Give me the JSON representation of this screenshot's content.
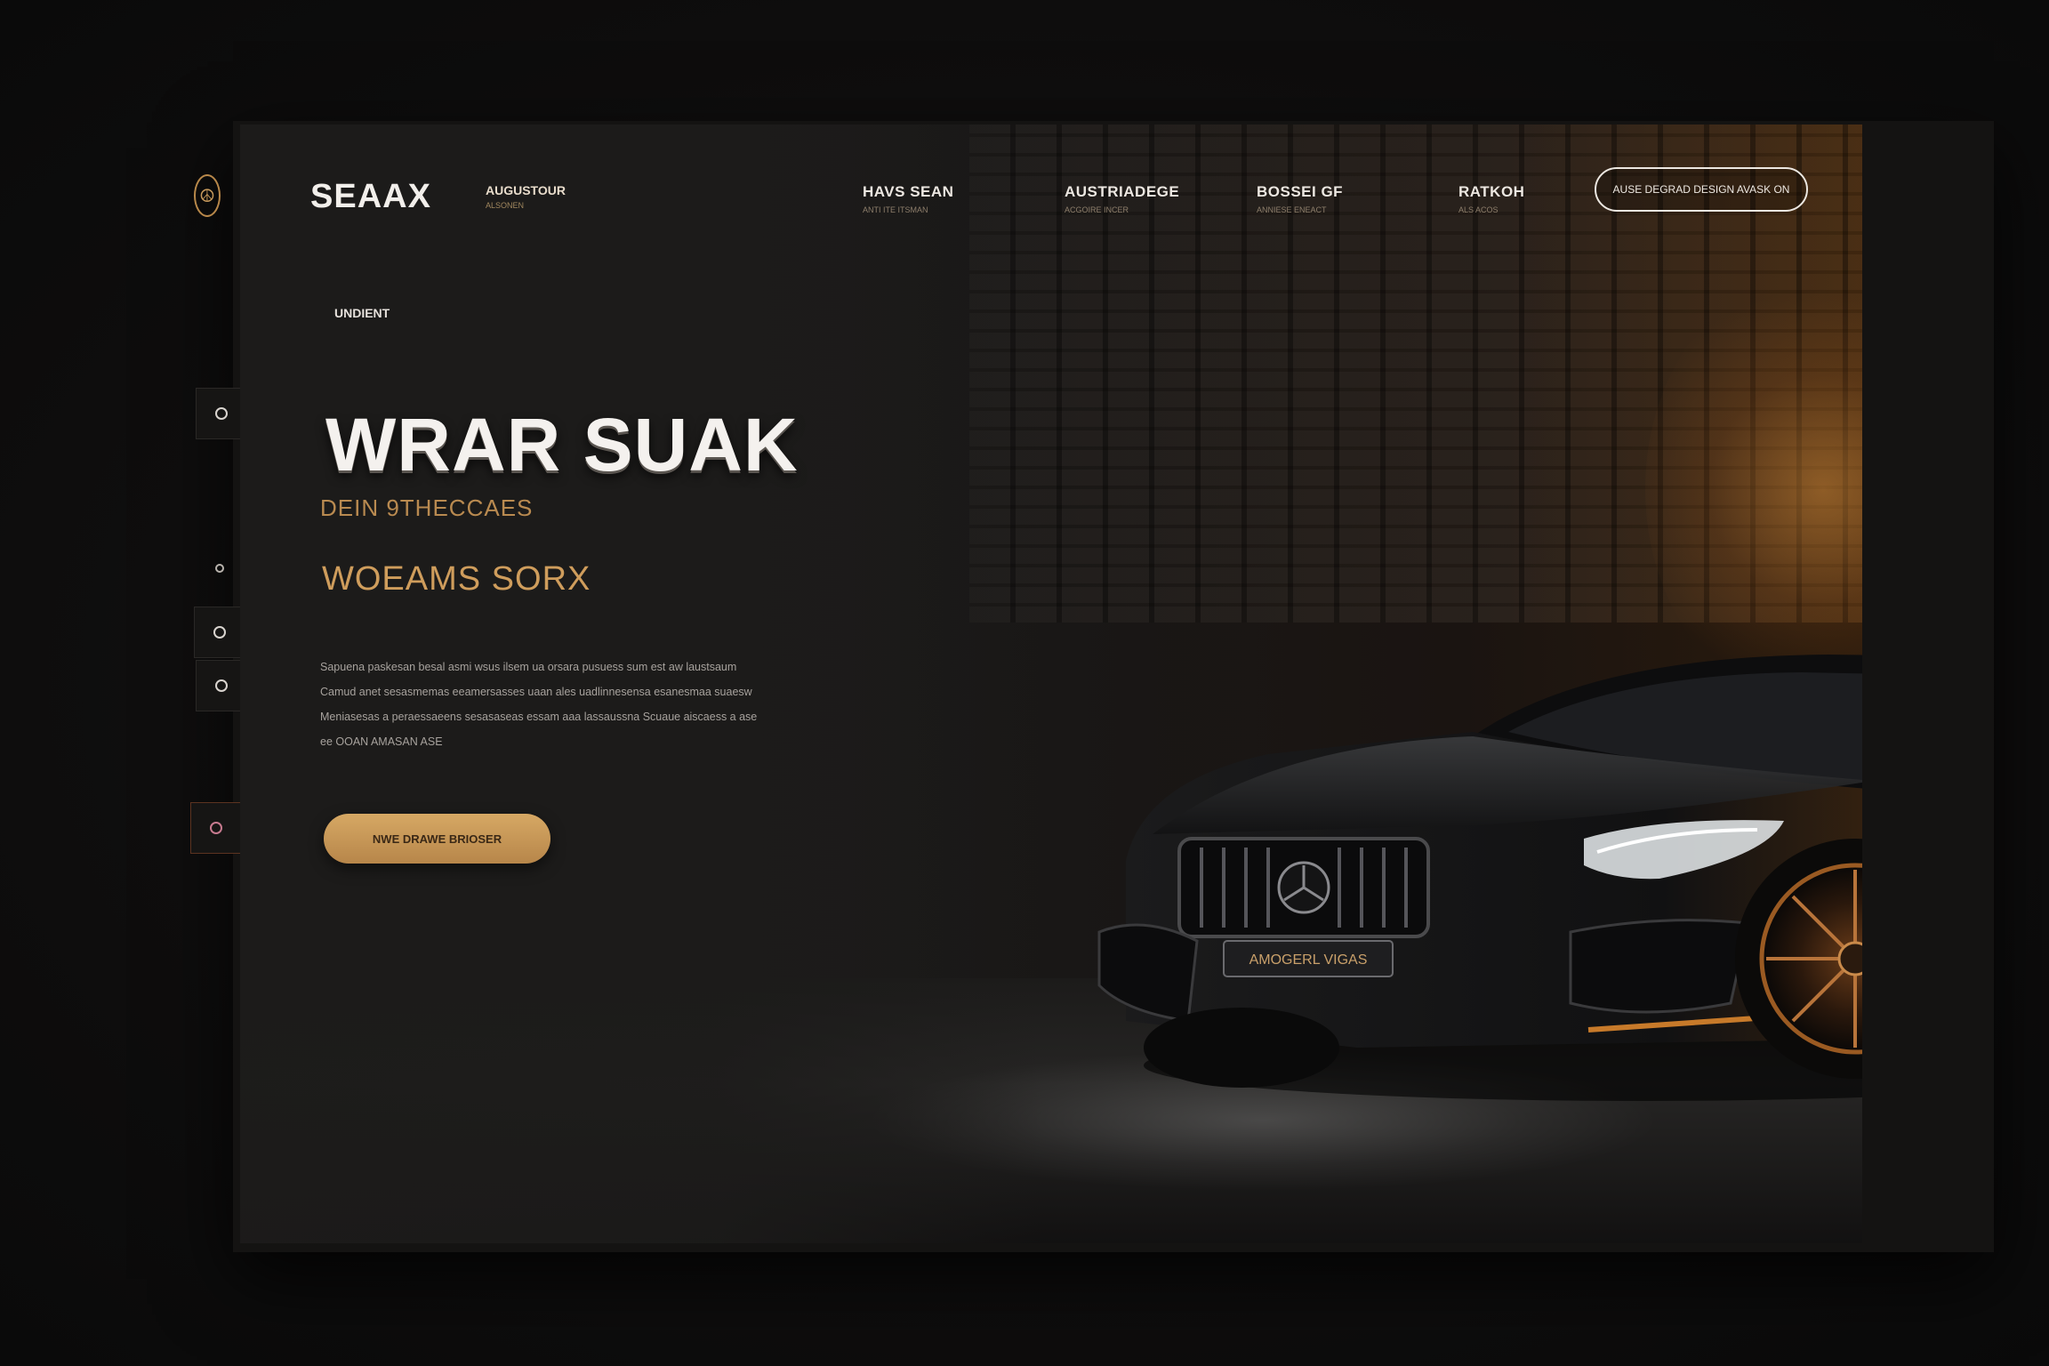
{
  "brand": {
    "name": "SEAAX",
    "sub_label": "AUGUSTOUR",
    "sub_caption": "ALSONEN"
  },
  "nav": {
    "items": [
      {
        "label": "HAVS SEAN",
        "caption": "ANTI ITE ITSMAN"
      },
      {
        "label": "AUSTRIADEGE",
        "caption": "ACGOIRE INCER"
      },
      {
        "label": "BOSSEI GF",
        "caption": "ANNIESE ENEACT"
      },
      {
        "label": "RATKOH",
        "caption": "ALS ACOS"
      }
    ],
    "cta_label": "AUSE DEGRAD DESIGN AVASK ON"
  },
  "hero": {
    "eyebrow": "UNDIENT",
    "headline": "WRAR SUAK",
    "subhead": "DEIN 9THECCAES",
    "tagline": "WOEAMS SORX",
    "body_lines": [
      "Sapuena paskesan besal asmi wsus ilsem ua orsara pusuess sum est aw laustsaum",
      "Camud anet sesasmemas eeamersasses uaan ales uadlinnesensa esanesmaa suaesw",
      "Meniasesas a peraessaeens sesasaseas essam aaa lassaussna Scuaue aiscaess a ase",
      "ee OOAN AMASAN ASE"
    ],
    "cta_label": "NWE DRAWE BRIOSER"
  },
  "car": {
    "plate_text": "AMOGERL VIGAS"
  },
  "icons": {
    "rail_logo": "brand-emblem-icon",
    "rail_items": [
      "circle-icon",
      "circle-icon",
      "circle-icon",
      "circle-icon",
      "circle-icon"
    ]
  },
  "colors": {
    "background": "#0d0c0c",
    "accent_gold": "#cf9d5c",
    "text_light": "#f4f1ee",
    "cta_gold": "#c99a58"
  }
}
